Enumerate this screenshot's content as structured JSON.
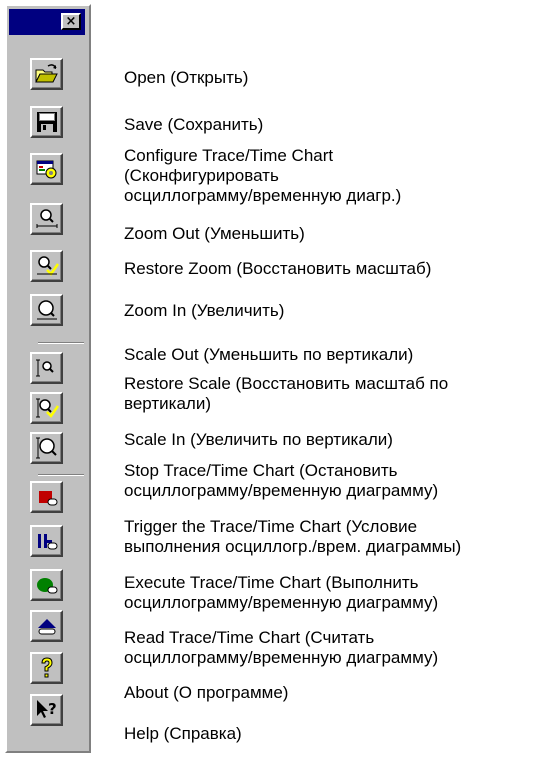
{
  "toolbar": {
    "close_glyph": "×",
    "buttons": [
      {
        "icon": "open-folder-icon",
        "label": "Open (Открыть)"
      },
      {
        "icon": "save-disk-icon",
        "label": "Save (Сохранить)"
      },
      {
        "icon": "configure-chart-icon",
        "label": "Configure Trace/Time Chart\n(Сконфигурировать\nосциллограмму/временную диагр.)"
      },
      {
        "icon": "zoom-out-icon",
        "label": "Zoom Out (Уменьшить)"
      },
      {
        "icon": "restore-zoom-icon",
        "label": "Restore Zoom (Восстановить масштаб)"
      },
      {
        "icon": "zoom-in-icon",
        "label": "Zoom In (Увеличить)"
      },
      {
        "icon": "scale-out-icon",
        "label": "Scale Out (Уменьшить по вертикали)"
      },
      {
        "icon": "restore-scale-icon",
        "label": "Restore Scale (Восстановить масштаб по\nвертикали)"
      },
      {
        "icon": "scale-in-icon",
        "label": "Scale In (Увеличить по вертикали)"
      },
      {
        "icon": "stop-chart-icon",
        "label": "Stop Trace/Time Chart (Остановить\nосциллограмму/временную диаграмму)"
      },
      {
        "icon": "trigger-chart-icon",
        "label": "Trigger the Trace/Time Chart (Условие\nвыполнения осциллогр./врем. диаграммы)"
      },
      {
        "icon": "execute-chart-icon",
        "label": "Execute Trace/Time Chart (Выполнить\nосциллограмму/временную диаграмму)"
      },
      {
        "icon": "read-chart-icon",
        "label": "Read Trace/Time Chart (Считать\nосциллограмму/временную диаграмму)"
      },
      {
        "icon": "about-icon",
        "label": "About (О программе)"
      },
      {
        "icon": "context-help-icon",
        "label": "Help (Справка)"
      }
    ]
  },
  "colors": {
    "face": "#c0c0c0",
    "titlebar": "#000080",
    "red": "#c00000",
    "green": "#008000",
    "navy": "#000080",
    "yellow": "#ffff00"
  }
}
